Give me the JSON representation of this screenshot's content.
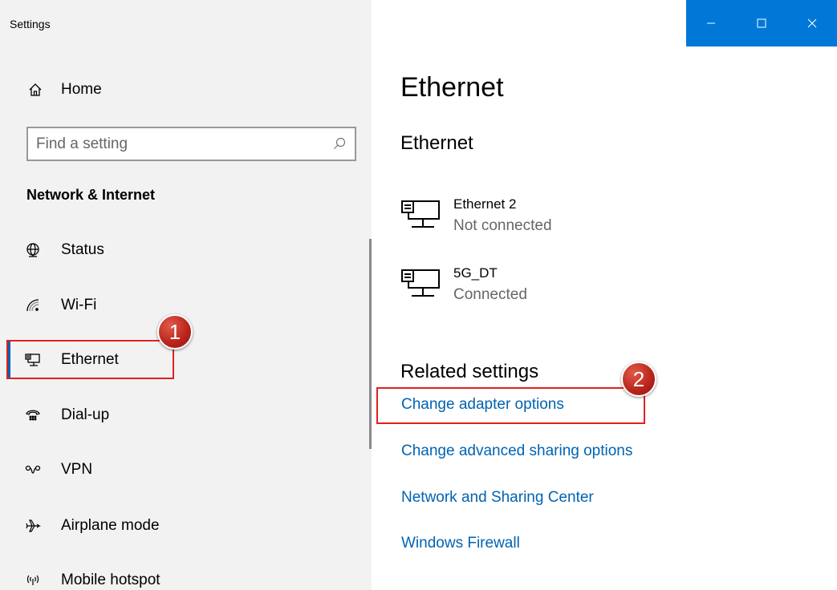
{
  "app": {
    "title": "Settings"
  },
  "window_controls": {
    "minimize": "minimize",
    "maximize": "maximize",
    "close": "close"
  },
  "sidebar": {
    "home_label": "Home",
    "search": {
      "placeholder": "Find a setting"
    },
    "section_title": "Network & Internet",
    "items": [
      {
        "label": "Status",
        "icon": "globe-icon"
      },
      {
        "label": "Wi-Fi",
        "icon": "wifi-icon"
      },
      {
        "label": "Ethernet",
        "icon": "ethernet-icon",
        "selected": true
      },
      {
        "label": "Dial-up",
        "icon": "dialup-icon"
      },
      {
        "label": "VPN",
        "icon": "vpn-icon"
      },
      {
        "label": "Airplane mode",
        "icon": "airplane-icon"
      },
      {
        "label": "Mobile hotspot",
        "icon": "hotspot-icon"
      }
    ]
  },
  "main": {
    "page_title": "Ethernet",
    "section_title": "Ethernet",
    "connections": [
      {
        "name": "Ethernet 2",
        "status": "Not connected"
      },
      {
        "name": "5G_DT",
        "status": "Connected"
      }
    ],
    "related_title": "Related settings",
    "related_links": [
      "Change adapter options",
      "Change advanced sharing options",
      "Network and Sharing Center",
      "Windows Firewall"
    ]
  },
  "annotations": {
    "badge1": "1",
    "badge2": "2"
  },
  "colors": {
    "accent": "#0078d7",
    "link": "#0063b1",
    "annotation": "#e02020"
  }
}
